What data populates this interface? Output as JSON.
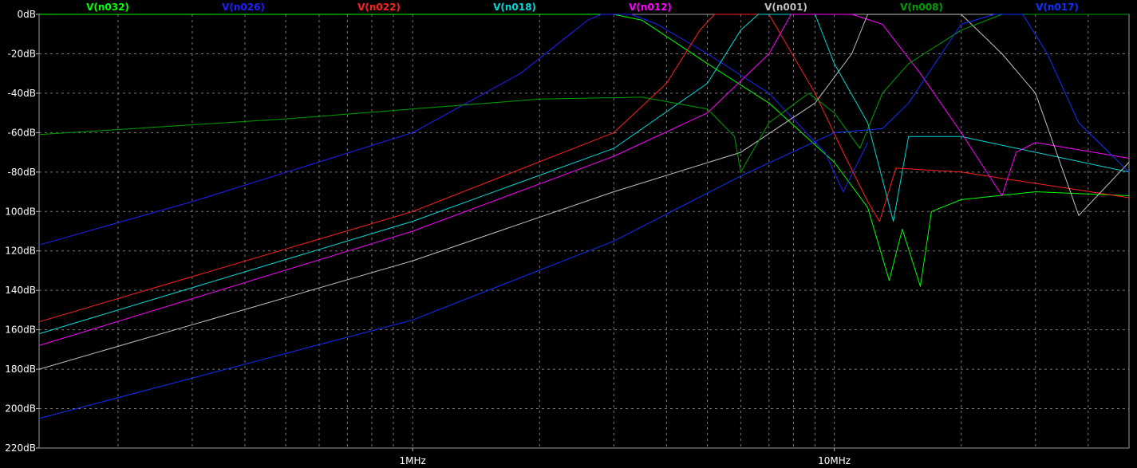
{
  "chart_data": {
    "type": "line",
    "title": "",
    "xlabel": "",
    "ylabel": "",
    "x_scale": "log",
    "xlim": [
      130000,
      50000000
    ],
    "ylim": [
      -220,
      0
    ],
    "grid": true,
    "legend_position": "top",
    "x_tick_labels": [
      {
        "value": 1000000,
        "label": "1MHz"
      },
      {
        "value": 10000000,
        "label": "10MHz"
      }
    ],
    "y_tick_labels": [
      {
        "value": 0,
        "label": "0dB"
      },
      {
        "value": -20,
        "label": "-20dB"
      },
      {
        "value": -40,
        "label": "-40dB"
      },
      {
        "value": -60,
        "label": "-60dB"
      },
      {
        "value": -80,
        "label": "-80dB"
      },
      {
        "value": -100,
        "label": "100dB"
      },
      {
        "value": -120,
        "label": "120dB"
      },
      {
        "value": -140,
        "label": "140dB"
      },
      {
        "value": -160,
        "label": "160dB"
      },
      {
        "value": -180,
        "label": "180dB"
      },
      {
        "value": -200,
        "label": "200dB"
      },
      {
        "value": -220,
        "label": "220dB"
      }
    ],
    "series": [
      {
        "name": "V(n032)",
        "color": "#00ff00",
        "x": [
          130000,
          1000000,
          3000000,
          3500000,
          5000000,
          7000000,
          10000000,
          12000000,
          13500000,
          14500000,
          16000000,
          17000000,
          20000000,
          30000000,
          50000000
        ],
        "y": [
          0,
          0,
          0,
          -3,
          -25,
          -45,
          -75,
          -98,
          -135,
          -109,
          -138,
          -100,
          -94,
          -90,
          -92
        ]
      },
      {
        "name": "V(n026)",
        "color": "#2020ff",
        "x": [
          130000,
          300000,
          1000000,
          1800000,
          2300000,
          2600000,
          2800000,
          3000000,
          3300000,
          3800000,
          5000000,
          7000000,
          9500000,
          10500000,
          12000000
        ],
        "y": [
          -117,
          -95,
          -60,
          -30,
          -12,
          -3,
          0,
          0,
          0,
          -5,
          -20,
          -40,
          -70,
          -90,
          -65
        ]
      },
      {
        "name": "V(n022)",
        "color": "#ff2020",
        "x": [
          130000,
          1000000,
          3000000,
          4000000,
          4800000,
          5200000,
          6000000,
          7000000,
          9000000,
          10500000,
          12000000,
          12800000,
          14000000,
          20000000,
          50000000
        ],
        "y": [
          -156,
          -100,
          -60,
          -35,
          -8,
          0,
          0,
          0,
          -40,
          -70,
          -95,
          -105,
          -78,
          -80,
          -93
        ]
      },
      {
        "name": "V(n018)",
        "color": "#00d8d8",
        "x": [
          130000,
          1000000,
          3000000,
          5000000,
          6000000,
          6600000,
          7500000,
          9000000,
          10000000,
          12000000,
          13800000,
          15000000,
          20000000,
          50000000
        ],
        "y": [
          -162,
          -105,
          -68,
          -35,
          -8,
          0,
          0,
          0,
          -25,
          -55,
          -105,
          -62,
          -62,
          -80
        ]
      },
      {
        "name": "V(n012)",
        "color": "#ff00ff",
        "x": [
          130000,
          1000000,
          3000000,
          5000000,
          7000000,
          7900000,
          9000000,
          11000000,
          13000000,
          16000000,
          20000000,
          25000000,
          27000000,
          30000000,
          50000000
        ],
        "y": [
          -168,
          -110,
          -72,
          -50,
          -20,
          0,
          0,
          0,
          -5,
          -30,
          -60,
          -92,
          -70,
          -65,
          -73
        ]
      },
      {
        "name": "V(n001)",
        "color": "#c0c0c0",
        "x": [
          130000,
          1000000,
          3000000,
          6000000,
          9000000,
          11000000,
          12000000,
          15000000,
          20000000,
          25000000,
          30000000,
          38000000,
          50000000
        ],
        "y": [
          -180,
          -125,
          -90,
          -70,
          -45,
          -20,
          0,
          0,
          0,
          -20,
          -40,
          -102,
          -75
        ]
      },
      {
        "name": "V(n008)",
        "color": "#00a000",
        "x": [
          130000,
          500000,
          2000000,
          3500000,
          5000000,
          5800000,
          6000000,
          7000000,
          8700000,
          10000000,
          11500000,
          13000000,
          15000000,
          20000000,
          25000000,
          30000000,
          50000000
        ],
        "y": [
          -61,
          -53,
          -43,
          -42,
          -48,
          -62,
          -80,
          -55,
          -40,
          -50,
          -68,
          -40,
          -25,
          -8,
          0,
          0,
          0
        ]
      },
      {
        "name": "V(n017)",
        "color": "#1030ff",
        "x": [
          130000,
          1000000,
          3000000,
          6000000,
          10000000,
          13000000,
          15000000,
          20000000,
          24000000,
          26000000,
          28000000,
          32000000,
          38000000,
          50000000
        ],
        "y": [
          -205,
          -155,
          -115,
          -82,
          -60,
          -58,
          -45,
          -5,
          0,
          0,
          0,
          -20,
          -55,
          -80
        ]
      }
    ]
  }
}
